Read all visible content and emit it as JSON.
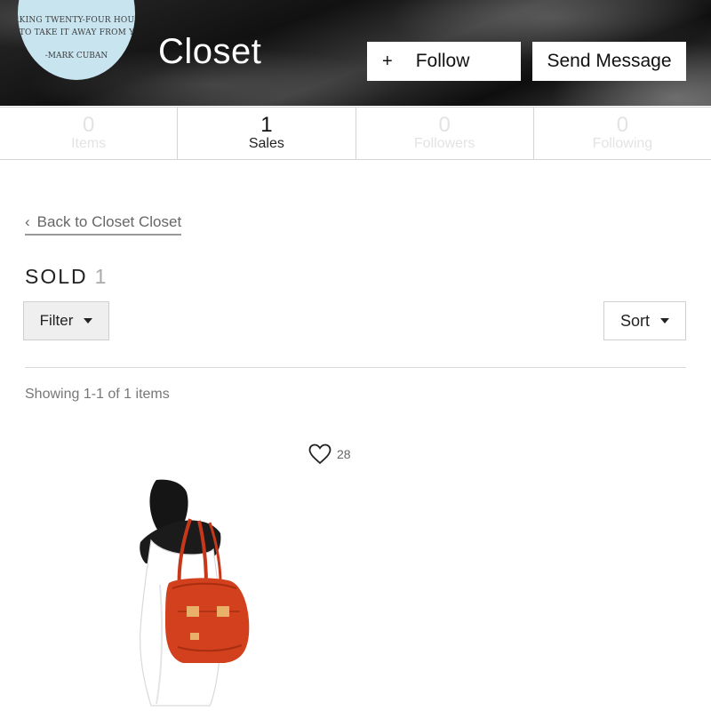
{
  "header": {
    "avatar_quote": {
      "line1": "WORKING TWENTY-FOUR HOURS A",
      "line2": "DAY TO TAKE IT AWAY FROM YOU.\"",
      "author": "-MARK CUBAN"
    },
    "title": "Closet",
    "follow_icon": "+",
    "follow_label": "Follow",
    "message_label": "Send Message"
  },
  "stats": [
    {
      "number": "0",
      "label": "Items",
      "active": false
    },
    {
      "number": "1",
      "label": "Sales",
      "active": true
    },
    {
      "number": "0",
      "label": "Followers",
      "active": false
    },
    {
      "number": "0",
      "label": "Following",
      "active": false
    }
  ],
  "back_link": "Back to Closet Closet",
  "section": {
    "heading": "SOLD",
    "count": "1"
  },
  "controls": {
    "filter_label": "Filter",
    "sort_label": "Sort"
  },
  "results_text": "Showing 1-1 of 1 items",
  "items": [
    {
      "likes": "28",
      "icon": "heart-outline-icon"
    }
  ],
  "colors": {
    "avatar_bg": "#c8e4ef",
    "bag": "#d2401d",
    "active_stat": "#111111",
    "inactive_stat": "#e3e3e3"
  }
}
